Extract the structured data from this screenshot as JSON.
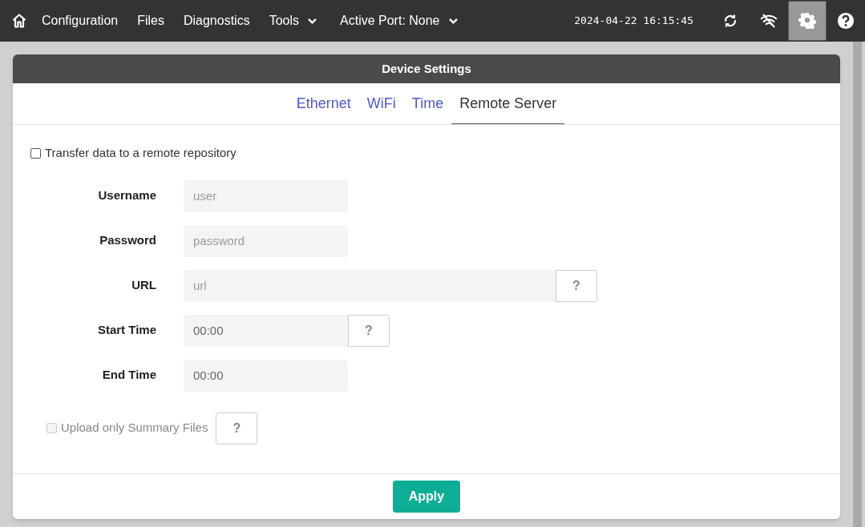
{
  "navbar": {
    "items": [
      {
        "label": "Configuration",
        "dropdown": false
      },
      {
        "label": "Files",
        "dropdown": false
      },
      {
        "label": "Diagnostics",
        "dropdown": false
      },
      {
        "label": "Tools",
        "dropdown": true
      },
      {
        "label": "Active Port: None",
        "dropdown": true
      }
    ],
    "clock": "2024-04-22 16:15:45",
    "tools": [
      {
        "kind": "sync",
        "selected": false
      },
      {
        "kind": "wifi-off",
        "selected": false
      },
      {
        "kind": "settings",
        "selected": true
      },
      {
        "kind": "help",
        "selected": false
      }
    ]
  },
  "card": {
    "title": "Device Settings",
    "tabs": [
      {
        "label": "Ethernet",
        "selected": false
      },
      {
        "label": "WiFi",
        "selected": false
      },
      {
        "label": "Time",
        "selected": false
      },
      {
        "label": "Remote Server",
        "selected": true
      }
    ],
    "transfer": {
      "label": "Transfer data to a remote repository",
      "checked": false,
      "disabled": false
    },
    "fields": [
      {
        "label": "Username",
        "placeholder": "user",
        "kind": "short",
        "help": false
      },
      {
        "label": "Password",
        "placeholder": "password",
        "kind": "short",
        "help": false
      },
      {
        "label": "URL",
        "placeholder": "url",
        "kind": "long",
        "help": true,
        "help_label": "?"
      },
      {
        "label": "Start Time",
        "value": "00:00",
        "kind": "short",
        "help": true,
        "help_label": "?"
      },
      {
        "label": "End Time",
        "value": "00:00",
        "kind": "short",
        "help": false
      }
    ],
    "summary": {
      "label": "Upload only Summary Files",
      "checked": false,
      "disabled": true,
      "help_label": "?"
    },
    "apply": "Apply"
  }
}
